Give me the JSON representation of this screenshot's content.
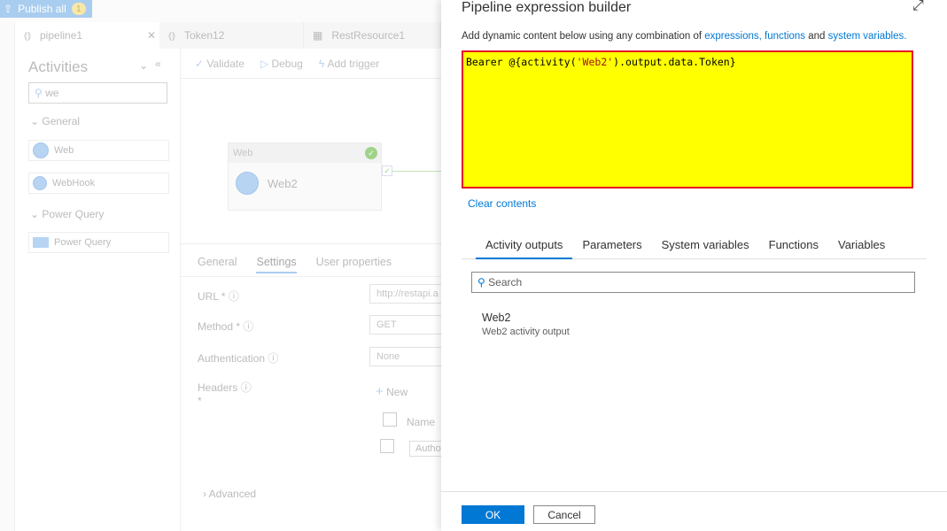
{
  "topbar": {
    "publish_label": "Publish all",
    "publish_count": "1"
  },
  "tabs": [
    {
      "label": "pipeline1"
    },
    {
      "label": "Token12"
    },
    {
      "label": "RestResource1"
    }
  ],
  "activities": {
    "title": "Activities",
    "search_value": "we",
    "groups": [
      {
        "label": "General",
        "items": [
          "Web",
          "WebHook"
        ]
      },
      {
        "label": "Power Query",
        "items": [
          "Power Query"
        ]
      }
    ]
  },
  "toolbar": {
    "validate": "Validate",
    "debug": "Debug",
    "add_trigger": "Add trigger"
  },
  "canvas": {
    "node_type": "Web",
    "node_name": "Web2"
  },
  "props": {
    "tabs": [
      "General",
      "Settings",
      "User properties"
    ],
    "active_tab": "Settings",
    "url_label": "URL *",
    "url_value": "http://restapi.a",
    "method_label": "Method *",
    "method_value": "GET",
    "auth_label": "Authentication",
    "auth_value": "None",
    "headers_label": "Headers",
    "headers_req": "*",
    "new_label": "New",
    "name_col": "Name",
    "header_row_name": "Autho",
    "advanced": "Advanced"
  },
  "builder": {
    "title": "Pipeline expression builder",
    "desc_prefix": "Add dynamic content below using any combination of ",
    "link_expressions": "expressions,",
    "link_functions": "functions",
    "desc_and": " and ",
    "link_system": "system variables.",
    "expr_prefix": "Bearer @{activity(",
    "expr_string": "'Web2'",
    "expr_suffix": ").output.data.Token}",
    "clear": "Clear contents",
    "tabs": [
      "Activity outputs",
      "Parameters",
      "System variables",
      "Functions",
      "Variables"
    ],
    "search_placeholder": "Search",
    "outputs": [
      {
        "name": "Web2",
        "desc": "Web2 activity output"
      }
    ],
    "ok": "OK",
    "cancel": "Cancel"
  },
  "colors": {
    "accent": "#0078d4",
    "editor_bg": "#ffff00",
    "editor_border": "#e81123"
  }
}
